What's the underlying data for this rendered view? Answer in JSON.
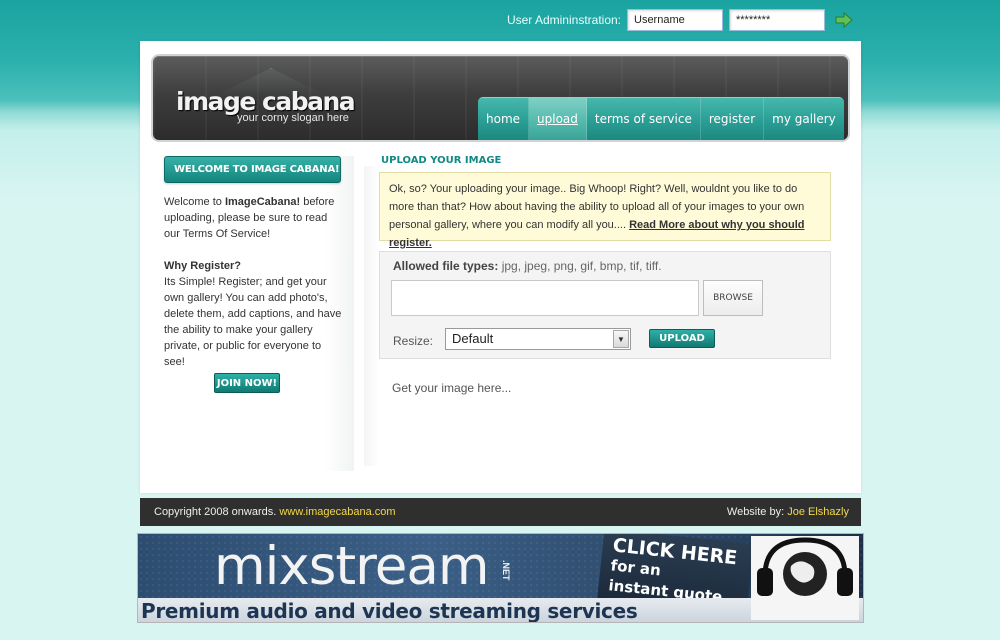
{
  "admin": {
    "label": "User Admininstration:",
    "username_value": "Username",
    "password_value": "********"
  },
  "brand": {
    "name": "image cabana",
    "slogan": "your corny slogan here"
  },
  "nav": {
    "items": [
      {
        "label": "home"
      },
      {
        "label": "upload",
        "active": true
      },
      {
        "label": "terms of service"
      },
      {
        "label": "register"
      },
      {
        "label": "my gallery"
      }
    ]
  },
  "sidebar": {
    "welcome_title": "WELCOME TO IMAGE CABANA!",
    "intro_prefix": "Welcome to ",
    "intro_brand": "ImageCabana!",
    "intro_rest": " before uploading, please be sure to read our Terms Of Service!",
    "why_title": "Why Register?",
    "why_text": "Its Simple! Register; and get your own gallery! You can add photo's, delete them, add captions, and have the ability to make your gallery private, or public for everyone to see!",
    "join_label": "JOIN NOW!"
  },
  "main": {
    "section_title": "UPLOAD YOUR IMAGE",
    "notice_text": "Ok, so? Your uploading your image.. Big Whoop! Right? Well, wouldnt you like to do more than that? How about having the ability to upload all of your images to your own personal gallery, where you can modify all you....",
    "notice_link": "Read More about why you should register.",
    "filetypes_label": "Allowed file types:",
    "filetypes_list": "jpg, jpeg, png, gif, bmp, tif, tiff.",
    "browse_label": "BROWSE",
    "resize_label": "Resize:",
    "resize_value": "Default",
    "upload_label": "UPLOAD",
    "result_text": "Get your image here..."
  },
  "footer": {
    "copyright": "Copyright 2008 onwards.",
    "site_link": "www.imagecabana.com",
    "credit_label": "Website by:",
    "credit_name": "Joe Elshazly"
  },
  "banner": {
    "brand": "mixstream",
    "tld": ".NET",
    "cta_line1": "CLICK HERE",
    "cta_line2": "for an",
    "cta_line3": "instant quote",
    "tagline": "Premium audio and video streaming services"
  },
  "icons": {
    "admin_go": "arrow-right-icon",
    "select_arrow": "chevron-down-icon"
  }
}
